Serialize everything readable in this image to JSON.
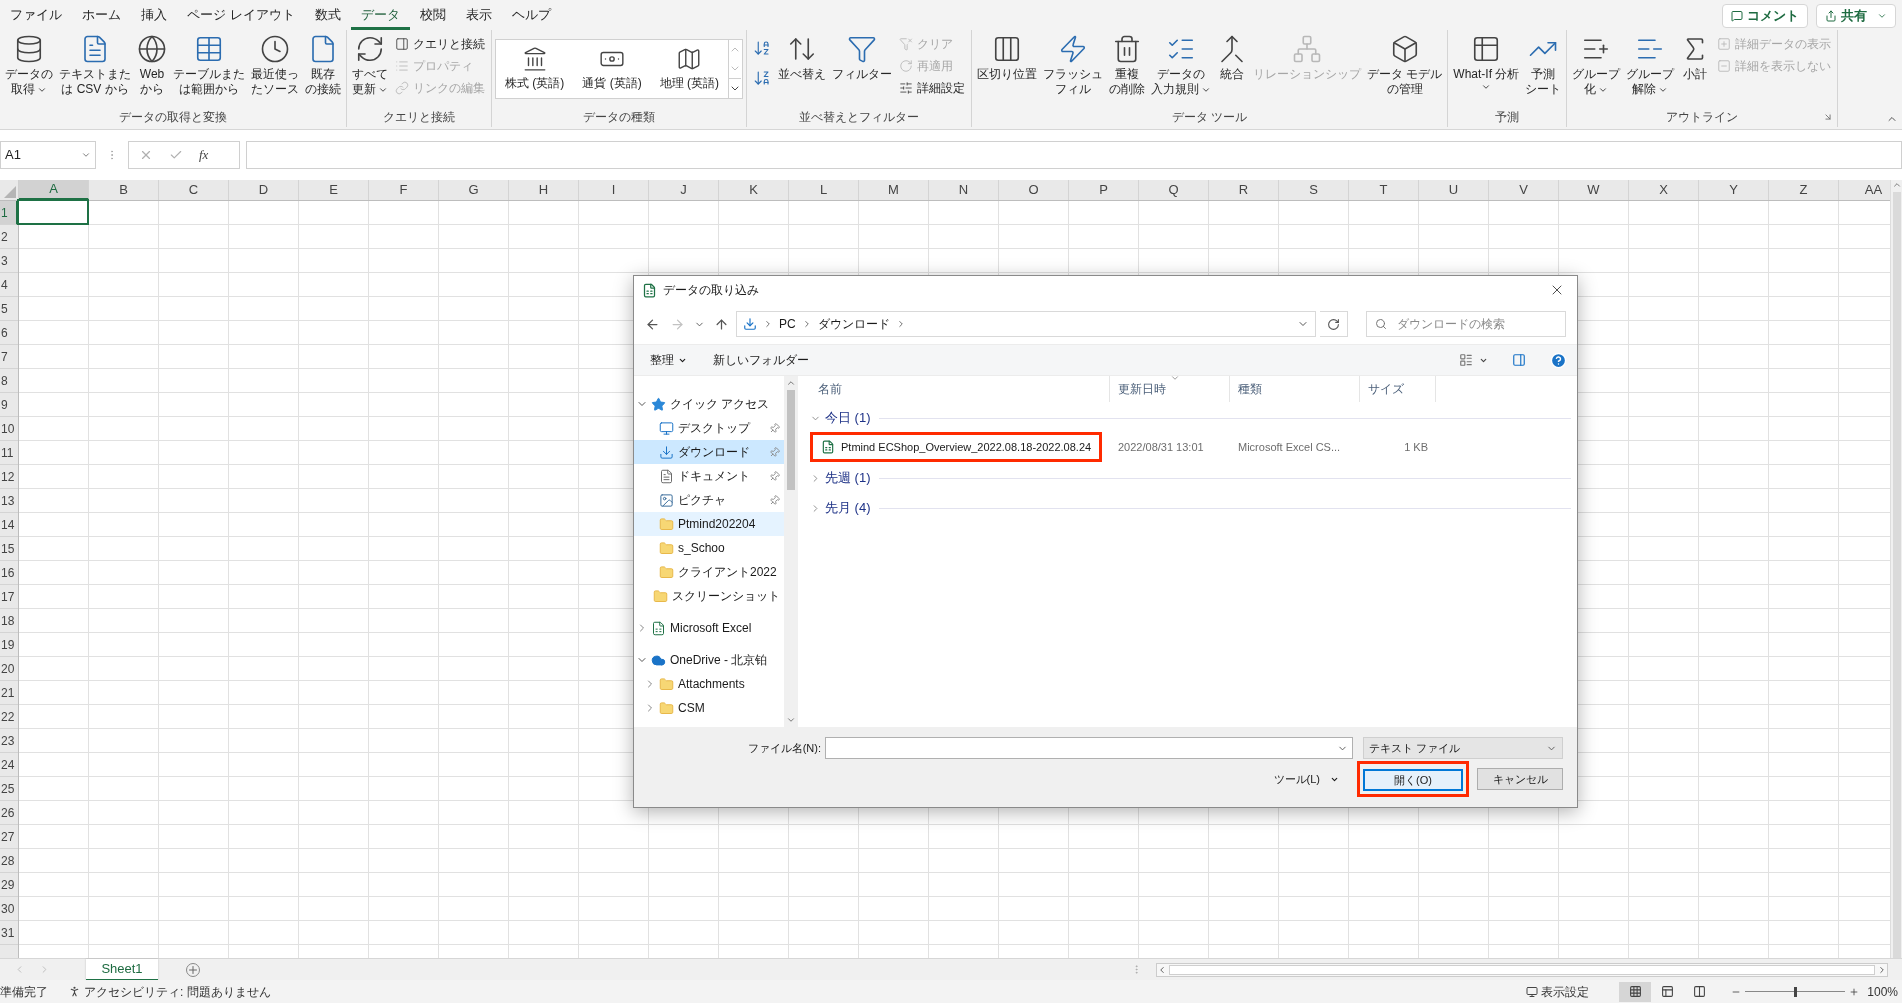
{
  "menu_tabs": [
    {
      "label": "ファイル",
      "selected": false
    },
    {
      "label": "ホーム",
      "selected": false
    },
    {
      "label": "挿入",
      "selected": false
    },
    {
      "label": "ページ レイアウト",
      "selected": false
    },
    {
      "label": "数式",
      "selected": false
    },
    {
      "label": "データ",
      "selected": true
    },
    {
      "label": "校閲",
      "selected": false
    },
    {
      "label": "表示",
      "selected": false
    },
    {
      "label": "ヘルプ",
      "selected": false
    }
  ],
  "comment_button": "コメント",
  "share_button": "共有",
  "ribbon": {
    "groups": [
      {
        "label": "データの取得と変換",
        "launcher": false,
        "items": [
          {
            "kind": "large",
            "lines": [
              "データの",
              "取得"
            ],
            "dropdown": true,
            "disabled": false
          },
          {
            "kind": "large",
            "lines": [
              "テキストまた",
              "は CSV から"
            ],
            "dropdown": false,
            "disabled": false
          },
          {
            "kind": "large",
            "lines": [
              "Web",
              "から"
            ],
            "dropdown": false,
            "disabled": false
          },
          {
            "kind": "large",
            "lines": [
              "テーブルまた",
              "は範囲から"
            ],
            "dropdown": false,
            "disabled": false
          },
          {
            "kind": "large",
            "lines": [
              "最近使っ",
              "たソース"
            ],
            "dropdown": false,
            "disabled": false
          },
          {
            "kind": "large",
            "lines": [
              "既存",
              "の接続"
            ],
            "dropdown": false,
            "disabled": false
          }
        ]
      },
      {
        "label": "クエリと接続",
        "launcher": false,
        "items": [
          {
            "kind": "large",
            "lines": [
              "すべて",
              "更新"
            ],
            "dropdown": true,
            "disabled": false
          },
          {
            "kind": "small",
            "label": "クエリと接続",
            "disabled": false
          },
          {
            "kind": "small",
            "label": "プロパティ",
            "disabled": true
          },
          {
            "kind": "small",
            "label": "リンクの編集",
            "disabled": true
          }
        ]
      },
      {
        "label": "データの種類",
        "launcher": false,
        "items": [
          {
            "kind": "gallery",
            "options": [
              "株式 (英語)",
              "通貨 (英語)",
              "地理 (英語)"
            ]
          }
        ]
      },
      {
        "label": "並べ替えとフィルター",
        "launcher": false,
        "items": [
          {
            "kind": "icon",
            "disabled": false
          },
          {
            "kind": "icon",
            "disabled": false
          },
          {
            "kind": "large",
            "lines": [
              "並べ替え"
            ],
            "dropdown": false,
            "disabled": false
          },
          {
            "kind": "large",
            "lines": [
              "フィルター"
            ],
            "dropdown": false,
            "disabled": false
          },
          {
            "kind": "small",
            "label": "クリア",
            "disabled": true
          },
          {
            "kind": "small",
            "label": "再適用",
            "disabled": true
          },
          {
            "kind": "small",
            "label": "詳細設定",
            "disabled": false
          }
        ]
      },
      {
        "label": "データ ツール",
        "launcher": false,
        "items": [
          {
            "kind": "large",
            "lines": [
              "区切り位置"
            ],
            "dropdown": false,
            "disabled": false
          },
          {
            "kind": "large",
            "lines": [
              "フラッシュ",
              "フィル"
            ],
            "dropdown": false,
            "disabled": false
          },
          {
            "kind": "large",
            "lines": [
              "重複",
              "の削除"
            ],
            "dropdown": false,
            "disabled": false
          },
          {
            "kind": "large",
            "lines": [
              "データの",
              "入力規則"
            ],
            "dropdown": true,
            "disabled": false
          },
          {
            "kind": "large",
            "lines": [
              "統合"
            ],
            "dropdown": false,
            "disabled": false
          },
          {
            "kind": "large",
            "lines": [
              "リレーションシップ"
            ],
            "dropdown": false,
            "disabled": true
          },
          {
            "kind": "large",
            "lines": [
              "データ モデル",
              "の管理"
            ],
            "dropdown": false,
            "disabled": false
          }
        ]
      },
      {
        "label": "予測",
        "launcher": false,
        "items": [
          {
            "kind": "large",
            "lines": [
              "What-If 分析"
            ],
            "dropdown": true,
            "disabled": false
          },
          {
            "kind": "large",
            "lines": [
              "予測",
              "シート"
            ],
            "dropdown": false,
            "disabled": false
          }
        ]
      },
      {
        "label": "アウトライン",
        "launcher": true,
        "items": [
          {
            "kind": "large",
            "lines": [
              "グループ",
              "化"
            ],
            "dropdown": true,
            "disabled": false
          },
          {
            "kind": "large",
            "lines": [
              "グループ",
              "解除"
            ],
            "dropdown": true,
            "disabled": false
          },
          {
            "kind": "large",
            "lines": [
              "小計"
            ],
            "dropdown": false,
            "disabled": false
          },
          {
            "kind": "small",
            "label": "詳細データの表示",
            "disabled": true
          },
          {
            "kind": "small",
            "label": "詳細を表示しない",
            "disabled": true
          }
        ]
      }
    ]
  },
  "formula_bar": {
    "name_box": "A1",
    "function_label": "fx"
  },
  "sheet": {
    "columns": [
      {
        "label": "A",
        "selected": true
      },
      {
        "label": "B",
        "selected": false
      },
      {
        "label": "C",
        "selected": false
      },
      {
        "label": "D",
        "selected": false
      },
      {
        "label": "E",
        "selected": false
      },
      {
        "label": "F",
        "selected": false
      },
      {
        "label": "G",
        "selected": false
      },
      {
        "label": "H",
        "selected": false
      },
      {
        "label": "I",
        "selected": false
      },
      {
        "label": "J",
        "selected": false
      },
      {
        "label": "K",
        "selected": false
      },
      {
        "label": "L",
        "selected": false
      },
      {
        "label": "M",
        "selected": false
      },
      {
        "label": "N",
        "selected": false
      },
      {
        "label": "O",
        "selected": false
      },
      {
        "label": "P",
        "selected": false
      },
      {
        "label": "Q",
        "selected": false
      },
      {
        "label": "R",
        "selected": false
      },
      {
        "label": "S",
        "selected": false
      },
      {
        "label": "T",
        "selected": false
      },
      {
        "label": "U",
        "selected": false
      },
      {
        "label": "V",
        "selected": false
      },
      {
        "label": "W",
        "selected": false
      },
      {
        "label": "X",
        "selected": false
      },
      {
        "label": "Y",
        "selected": false
      },
      {
        "label": "Z",
        "selected": false
      },
      {
        "label": "AA",
        "selected": false
      }
    ],
    "rows": [
      {
        "label": "1",
        "selected": true
      },
      {
        "label": "2",
        "selected": false
      },
      {
        "label": "3",
        "selected": false
      },
      {
        "label": "4",
        "selected": false
      },
      {
        "label": "5",
        "selected": false
      },
      {
        "label": "6",
        "selected": false
      },
      {
        "label": "7",
        "selected": false
      },
      {
        "label": "8",
        "selected": false
      },
      {
        "label": "9",
        "selected": false
      },
      {
        "label": "10",
        "selected": false
      },
      {
        "label": "11",
        "selected": false
      },
      {
        "label": "12",
        "selected": false
      },
      {
        "label": "13",
        "selected": false
      },
      {
        "label": "14",
        "selected": false
      },
      {
        "label": "15",
        "selected": false
      },
      {
        "label": "16",
        "selected": false
      },
      {
        "label": "17",
        "selected": false
      },
      {
        "label": "18",
        "selected": false
      },
      {
        "label": "19",
        "selected": false
      },
      {
        "label": "20",
        "selected": false
      },
      {
        "label": "21",
        "selected": false
      },
      {
        "label": "22",
        "selected": false
      },
      {
        "label": "23",
        "selected": false
      },
      {
        "label": "24",
        "selected": false
      },
      {
        "label": "25",
        "selected": false
      },
      {
        "label": "26",
        "selected": false
      },
      {
        "label": "27",
        "selected": false
      },
      {
        "label": "28",
        "selected": false
      },
      {
        "label": "29",
        "selected": false
      },
      {
        "label": "30",
        "selected": false
      },
      {
        "label": "31",
        "selected": false
      }
    ]
  },
  "dialog": {
    "title": "データの取り込み",
    "address": [
      "PC",
      "ダウンロード"
    ],
    "search_placeholder": "ダウンロードの検索",
    "toolbar": {
      "organize": "整理",
      "new_folder": "新しいフォルダー"
    },
    "nav_pane": [
      {
        "label": "クイック アクセス",
        "kind": "quick_access",
        "expanded": true,
        "selected": false,
        "hovered": false,
        "children": [
          {
            "label": "デスクトップ",
            "kind": "desktop",
            "pinned": true,
            "selected": false,
            "hovered": false
          },
          {
            "label": "ダウンロード",
            "kind": "download",
            "pinned": true,
            "selected": true,
            "hovered": false
          },
          {
            "label": "ドキュメント",
            "kind": "document",
            "pinned": true,
            "selected": false,
            "hovered": false
          },
          {
            "label": "ピクチャ",
            "kind": "picture",
            "pinned": true,
            "selected": false,
            "hovered": false
          },
          {
            "label": "Ptmind202204",
            "kind": "folder",
            "pinned": false,
            "selected": false,
            "hovered": true
          },
          {
            "label": "s_Schoo",
            "kind": "folder",
            "pinned": false,
            "selected": false,
            "hovered": false
          },
          {
            "label": "クライアント2022",
            "kind": "folder",
            "pinned": false,
            "selected": false,
            "hovered": false
          },
          {
            "label": "スクリーンショット",
            "kind": "folder",
            "pinned": false,
            "selected": false,
            "hovered": false
          }
        ]
      },
      {
        "label": "Microsoft Excel",
        "kind": "excel",
        "expanded": false,
        "selected": false,
        "hovered": false
      },
      {
        "label": "OneDrive - 北京铂",
        "kind": "onedrive",
        "expanded": true,
        "selected": false,
        "hovered": false,
        "children": [
          {
            "label": "Attachments",
            "kind": "folder",
            "expanded": false,
            "selected": false,
            "hovered": false
          },
          {
            "label": "CSM",
            "kind": "folder",
            "expanded": false,
            "selected": false,
            "hovered": false
          }
        ]
      }
    ],
    "columns": [
      {
        "label": "名前",
        "sorted": false
      },
      {
        "label": "更新日時",
        "sorted": true
      },
      {
        "label": "種類",
        "sorted": false
      },
      {
        "label": "サイズ",
        "sorted": false
      }
    ],
    "groups": [
      {
        "label": "今日 (1)",
        "expanded": true,
        "files": [
          {
            "name": "Ptmind ECShop_Overview_2022.08.18-2022.08.24",
            "date": "2022/08/31 13:01",
            "type": "Microsoft Excel CS...",
            "size": "1 KB",
            "annotated": true
          }
        ]
      },
      {
        "label": "先週 (1)",
        "expanded": false
      },
      {
        "label": "先月 (4)",
        "expanded": false
      }
    ],
    "file_name_label": "ファイル名(N):",
    "file_type": "テキスト ファイル",
    "tools": "ツール(L)",
    "buttons": [
      {
        "label": "開く(O)",
        "kind": "primary",
        "annotated": true
      },
      {
        "label": "キャンセル",
        "kind": "secondary",
        "annotated": false
      }
    ]
  },
  "sheet_tabs": [
    {
      "label": "Sheet1",
      "selected": true
    }
  ],
  "status_bar": {
    "ready": "準備完了",
    "accessibility": "アクセシビリティ: 問題ありません",
    "display_settings": "表示設定",
    "views": [
      {
        "selected": true
      },
      {
        "selected": false
      },
      {
        "selected": false
      }
    ],
    "zoom": {
      "level": 0.5,
      "reading": "100%"
    }
  }
}
